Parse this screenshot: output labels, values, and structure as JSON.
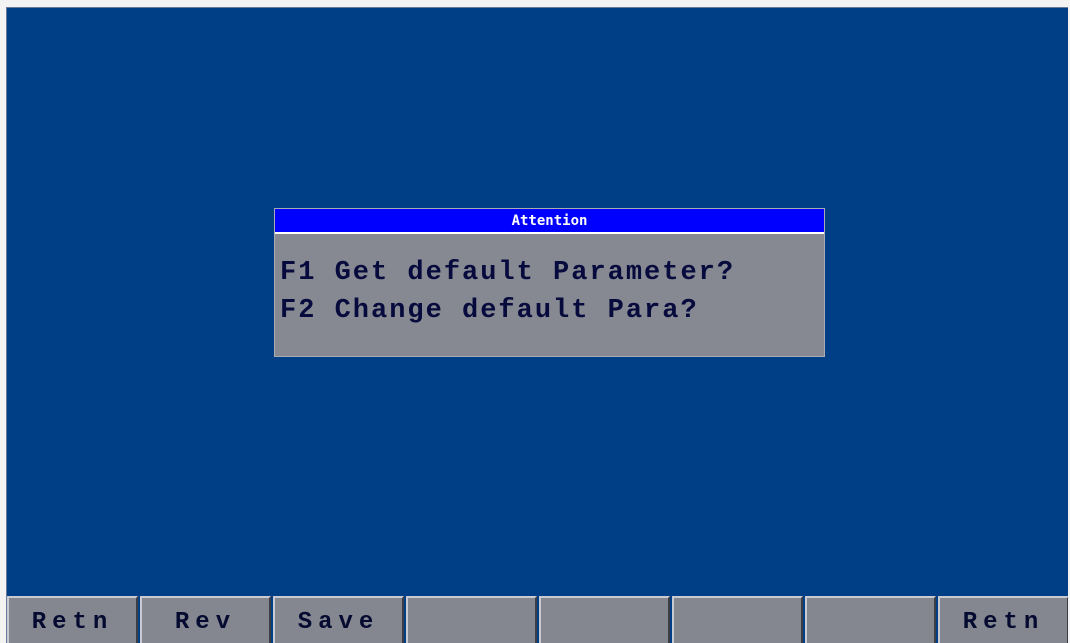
{
  "dialog": {
    "title": "Attention",
    "lines": [
      "F1 Get default Parameter?",
      "F2 Change default Para?"
    ]
  },
  "function_keys": [
    {
      "label": "Retn"
    },
    {
      "label": "Rev"
    },
    {
      "label": "Save"
    },
    {
      "label": ""
    },
    {
      "label": ""
    },
    {
      "label": ""
    },
    {
      "label": ""
    },
    {
      "label": "Retn"
    }
  ],
  "colors": {
    "screen_background": "#003f86",
    "dialog_background": "#878992",
    "dialog_title_background": "#0000ff",
    "key_background": "#858790"
  }
}
